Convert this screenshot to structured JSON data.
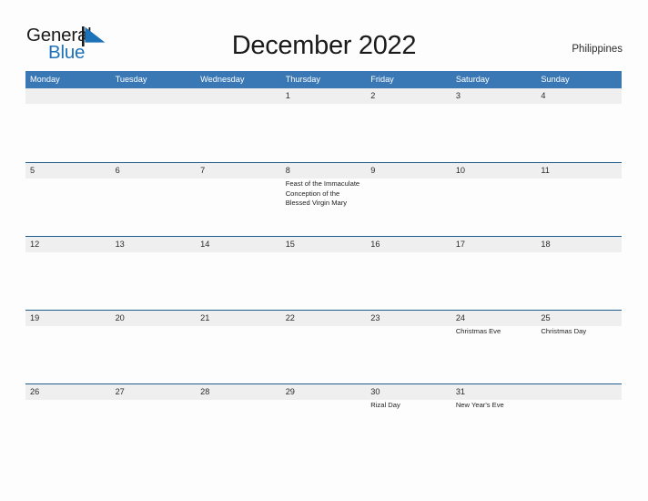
{
  "brand": {
    "name_part1": "General",
    "name_part2": "Blue",
    "flag_icon": "blue-triangle-flag-icon",
    "accent_color": "#1d72b8"
  },
  "header": {
    "title": "December 2022",
    "country": "Philippines"
  },
  "calendar": {
    "month": "December",
    "year": "2022",
    "header_color": "#3a78b5",
    "band_color": "#efefef",
    "rule_color": "#1f5c8b",
    "weekdays": [
      "Monday",
      "Tuesday",
      "Wednesday",
      "Thursday",
      "Friday",
      "Saturday",
      "Sunday"
    ],
    "weeks": [
      [
        {
          "day": "",
          "event": ""
        },
        {
          "day": "",
          "event": ""
        },
        {
          "day": "",
          "event": ""
        },
        {
          "day": "1",
          "event": ""
        },
        {
          "day": "2",
          "event": ""
        },
        {
          "day": "3",
          "event": ""
        },
        {
          "day": "4",
          "event": ""
        }
      ],
      [
        {
          "day": "5",
          "event": ""
        },
        {
          "day": "6",
          "event": ""
        },
        {
          "day": "7",
          "event": ""
        },
        {
          "day": "8",
          "event": "Feast of the Immaculate Conception of the Blessed Virgin Mary"
        },
        {
          "day": "9",
          "event": ""
        },
        {
          "day": "10",
          "event": ""
        },
        {
          "day": "11",
          "event": ""
        }
      ],
      [
        {
          "day": "12",
          "event": ""
        },
        {
          "day": "13",
          "event": ""
        },
        {
          "day": "14",
          "event": ""
        },
        {
          "day": "15",
          "event": ""
        },
        {
          "day": "16",
          "event": ""
        },
        {
          "day": "17",
          "event": ""
        },
        {
          "day": "18",
          "event": ""
        }
      ],
      [
        {
          "day": "19",
          "event": ""
        },
        {
          "day": "20",
          "event": ""
        },
        {
          "day": "21",
          "event": ""
        },
        {
          "day": "22",
          "event": ""
        },
        {
          "day": "23",
          "event": ""
        },
        {
          "day": "24",
          "event": "Christmas Eve"
        },
        {
          "day": "25",
          "event": "Christmas Day"
        }
      ],
      [
        {
          "day": "26",
          "event": ""
        },
        {
          "day": "27",
          "event": ""
        },
        {
          "day": "28",
          "event": ""
        },
        {
          "day": "29",
          "event": ""
        },
        {
          "day": "30",
          "event": "Rizal Day"
        },
        {
          "day": "31",
          "event": "New Year's Eve"
        },
        {
          "day": "",
          "event": ""
        }
      ]
    ]
  }
}
